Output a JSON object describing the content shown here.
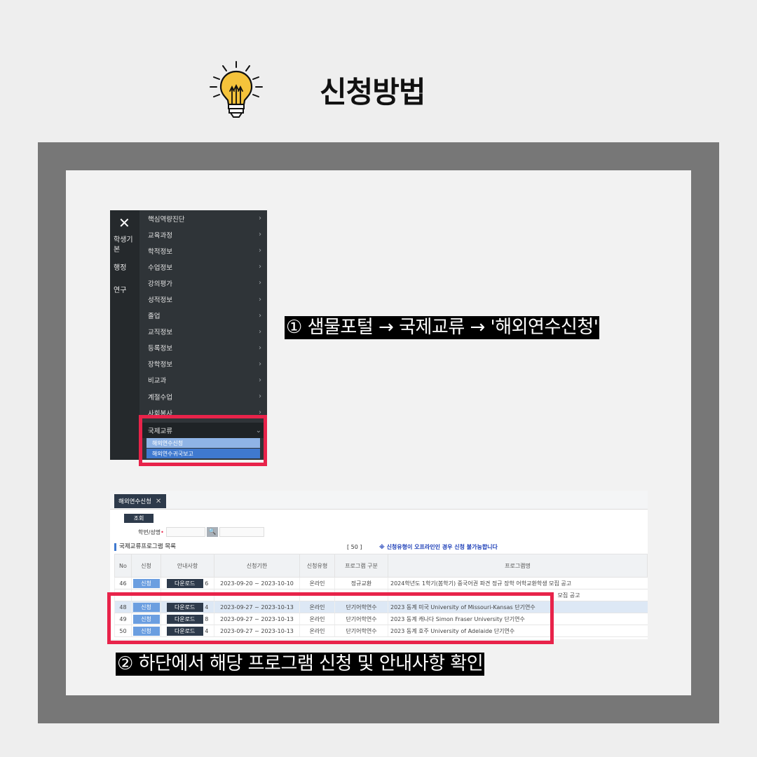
{
  "header": {
    "title": "신청방법",
    "icon": "lightbulb-icon"
  },
  "sidebar": {
    "close": "✕",
    "rail": [
      "학생기본",
      "행정",
      "연구"
    ],
    "items": [
      "핵심역량진단",
      "교육과정",
      "학적정보",
      "수업정보",
      "강의평가",
      "성적정보",
      "졸업",
      "교직정보",
      "등록정보",
      "장학정보",
      "비교과",
      "계절수업",
      "사회봉사"
    ],
    "active": "국제교류",
    "sub_items": [
      "해외연수신청",
      "해외연수귀국보고"
    ]
  },
  "captions": {
    "step1": "① 샘물포털 → 국제교류 → '해외연수신청'",
    "step2": "② 하단에서 해당 프로그램 신청 및 안내사항 확인"
  },
  "app": {
    "tab_label": "해외연수신청",
    "tab_close": "✕",
    "search_button": "조회",
    "field_label": "학번/성명",
    "search_icon": "🔍",
    "list_title": "국제교류프로그램 목록",
    "page_size": "[ 50 ]",
    "notice": "※ 신청유형이 오프라인인 경우 신청 불가능합니다",
    "columns": [
      "No",
      "신청",
      "안내사항",
      "신청기한",
      "신청유형",
      "프로그램 구분",
      "프로그램명"
    ],
    "rows": [
      {
        "no": "46",
        "apply": "신청",
        "dl": "다운로드",
        "count": "6",
        "period": "2023-09-20 ~ 2023-10-10",
        "type": "온라인",
        "category": "정규교환",
        "name": "2024학년도 1학기(봄학기) 중국어권 파견 정규 장학 어학교환학생 모집 공고"
      },
      {
        "no": "",
        "apply": "",
        "dl": "",
        "count": "",
        "period": "",
        "type": "",
        "category": "",
        "name": "모집 공고"
      },
      {
        "no": "48",
        "apply": "신청",
        "dl": "다운로드",
        "count": "4",
        "period": "2023-09-27 ~ 2023-10-13",
        "type": "온라인",
        "category": "단기어학연수",
        "name": "2023 동계 미국 University of Missouri-Kansas 단기연수"
      },
      {
        "no": "49",
        "apply": "신청",
        "dl": "다운로드",
        "count": "8",
        "period": "2023-09-27 ~ 2023-10-13",
        "type": "온라인",
        "category": "단기어학연수",
        "name": "2023 동계 캐나다 Simon Fraser University 단기연수"
      },
      {
        "no": "50",
        "apply": "신청",
        "dl": "다운로드",
        "count": "4",
        "period": "2023-09-27 ~ 2023-10-13",
        "type": "온라인",
        "category": "단기어학연수",
        "name": "2023 동계 호주 University of Adelaide 단기연수"
      }
    ]
  },
  "colors": {
    "highlight": "#e8234a",
    "frame": "#777777",
    "panel": "#f2f2f2",
    "bulb": "#f5c33b"
  }
}
